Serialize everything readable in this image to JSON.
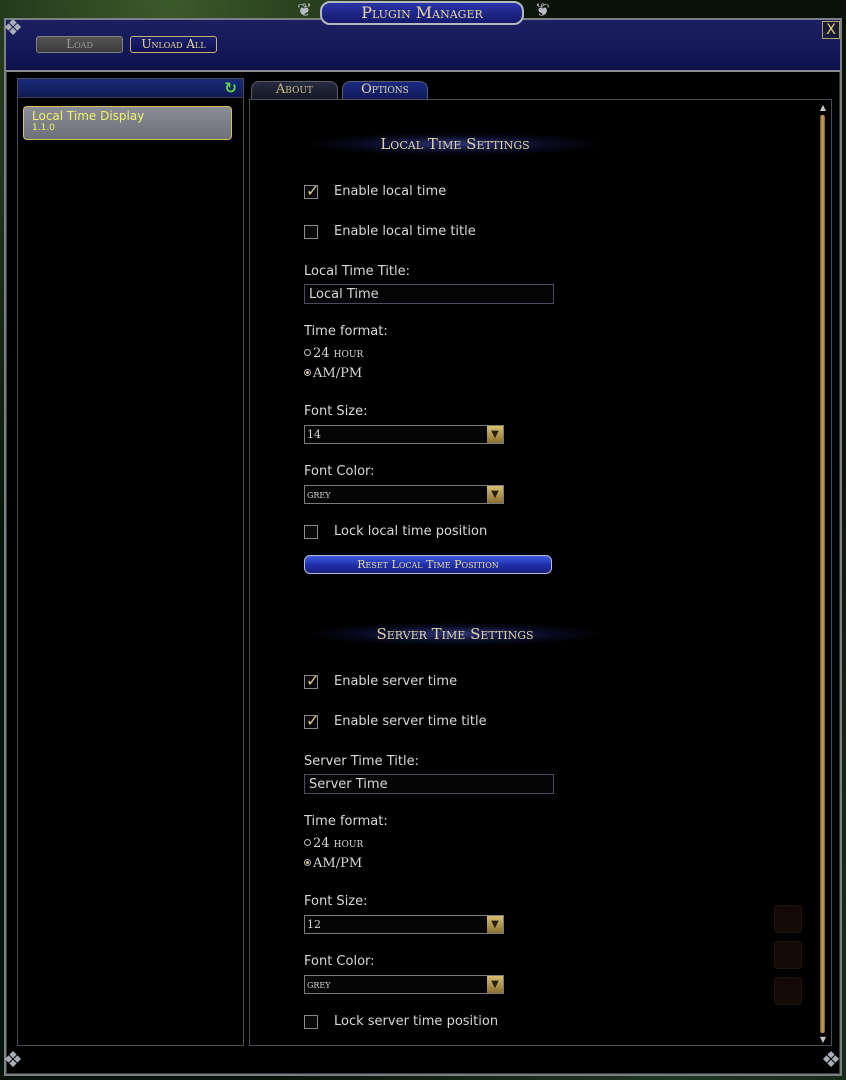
{
  "window": {
    "title": "Plugin Manager",
    "close_glyph": "X"
  },
  "toolbar": {
    "load_label": "Load",
    "unload_all_label": "Unload All"
  },
  "plugin_list": {
    "refresh_icon": "refresh-icon",
    "items": [
      {
        "name": "Local Time Display",
        "version": "1.1.0",
        "selected": true
      }
    ]
  },
  "tabs": [
    {
      "label": "About",
      "active": false
    },
    {
      "label": "Options",
      "active": true
    }
  ],
  "local": {
    "section_title": "Local Time Settings",
    "enable_label": "Enable local time",
    "enable_checked": true,
    "enable_title_label": "Enable local time title",
    "enable_title_checked": false,
    "title_field_label": "Local Time Title:",
    "title_value": "Local Time",
    "time_format_label": "Time format:",
    "format_24": "24 hour",
    "format_ampm": "AM/PM",
    "format_selected": "AM/PM",
    "font_size_label": "Font Size:",
    "font_size_value": "14",
    "font_color_label": "Font Color:",
    "font_color_value": "grey",
    "lock_label": "Lock local time position",
    "lock_checked": false,
    "reset_button_label": "Reset Local Time Position"
  },
  "server": {
    "section_title": "Server Time Settings",
    "enable_label": "Enable server time",
    "enable_checked": true,
    "enable_title_label": "Enable server time title",
    "enable_title_checked": true,
    "title_field_label": "Server Time Title:",
    "title_value": "Server Time",
    "time_format_label": "Time format:",
    "format_24": "24 hour",
    "format_ampm": "AM/PM",
    "format_selected": "AM/PM",
    "font_size_label": "Font Size:",
    "font_size_value": "12",
    "font_color_label": "Font Color:",
    "font_color_value": "grey",
    "lock_label": "Lock server time position",
    "lock_checked": false
  },
  "glyphs": {
    "checkmark": "✓",
    "dropdown_arrow": "▼",
    "scroll_up": "▲",
    "scroll_down": "▼",
    "refresh": "↻",
    "corner": "❖"
  },
  "colors": {
    "header_bg": "#141858",
    "gold_text": "#e0d4a8",
    "plugin_name": "#f1f16a",
    "refresh_green": "#5fd74a"
  }
}
